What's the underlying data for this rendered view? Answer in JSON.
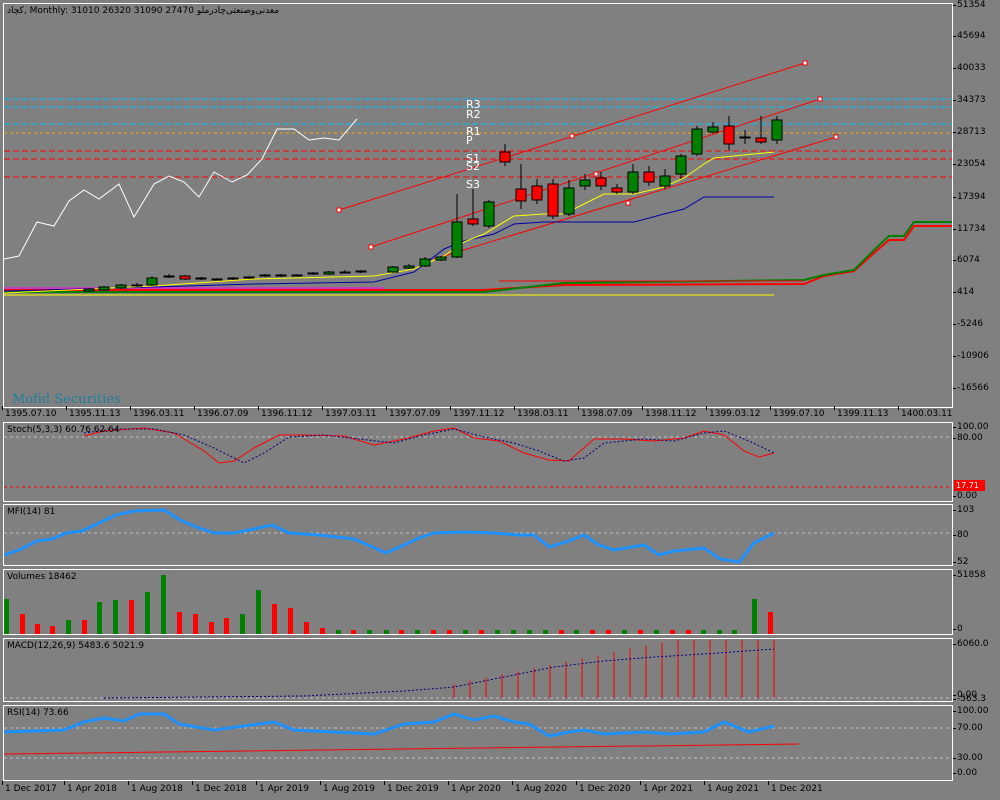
{
  "header": {
    "symbol_title": "کچاد, Monthly:  31010 26320 31090 27470  معدنی‌وصنعتی‌چادرملو"
  },
  "watermark": "Mofid Securities",
  "pivot_labels": [
    "R3",
    "R2",
    "R1",
    "P",
    "S1",
    "S2",
    "S3"
  ],
  "price_axis": [
    "51354",
    "45694",
    "40033",
    "34373",
    "28713",
    "23054",
    "17394",
    "11734",
    "6074",
    "414",
    "-5246",
    "-10906",
    "-16566"
  ],
  "main_time_axis": [
    "1395.07.10",
    "1395.11.13",
    "1396.03.11",
    "1396.07.09",
    "1396.11.12",
    "1397.03.11",
    "1397.07.09",
    "1397.11.12",
    "1398.03.11",
    "1398.07.09",
    "1398.11.12",
    "1399.03.12",
    "1399.07.10",
    "1399.11.13",
    "1400.03.11"
  ],
  "bottom_time_axis": [
    "1 Dec 2017",
    "1 Apr 2018",
    "1 Aug 2018",
    "1 Dec 2018",
    "1 Apr 2019",
    "1 Aug 2019",
    "1 Dec 2019",
    "1 Apr 2020",
    "1 Aug 2020",
    "1 Dec 2020",
    "1 Apr 2021",
    "1 Aug 2021",
    "1 Dec 2021"
  ],
  "indicators": {
    "stoch": {
      "label": "Stoch(5,3,3) 60.76 62.64",
      "axis": [
        "100.00",
        "80.00",
        "0.00"
      ],
      "level_tag": "17.71"
    },
    "mfi": {
      "label": "MFI(14) 81",
      "axis": [
        "103",
        "80",
        "52"
      ]
    },
    "volumes": {
      "label": "Volumes 18462",
      "axis": [
        "51858",
        "0"
      ]
    },
    "macd": {
      "label": "MACD(12,26,9) 5483.6 5021.9",
      "axis": [
        "6060.0",
        "0.00",
        "-563.3"
      ]
    },
    "rsi": {
      "label": "RSI(14) 73.66",
      "axis": [
        "100.00",
        "70.00",
        "30.00",
        "0.00"
      ]
    }
  },
  "colors": {
    "background": "#808080",
    "bull_candle": "#008000",
    "bear_candle": "#ff0000",
    "channel": "#ff0000",
    "pivot_blue": "#00bfff",
    "pivot_orange": "#ffa500",
    "pivot_red": "#ff0000",
    "line_white": "#ffffff",
    "line_yellow": "#ffff00",
    "line_navy": "#0000aa",
    "mfi": "#1e90ff",
    "stoch_main": "#ff0000",
    "stoch_signal": "#000080"
  }
}
